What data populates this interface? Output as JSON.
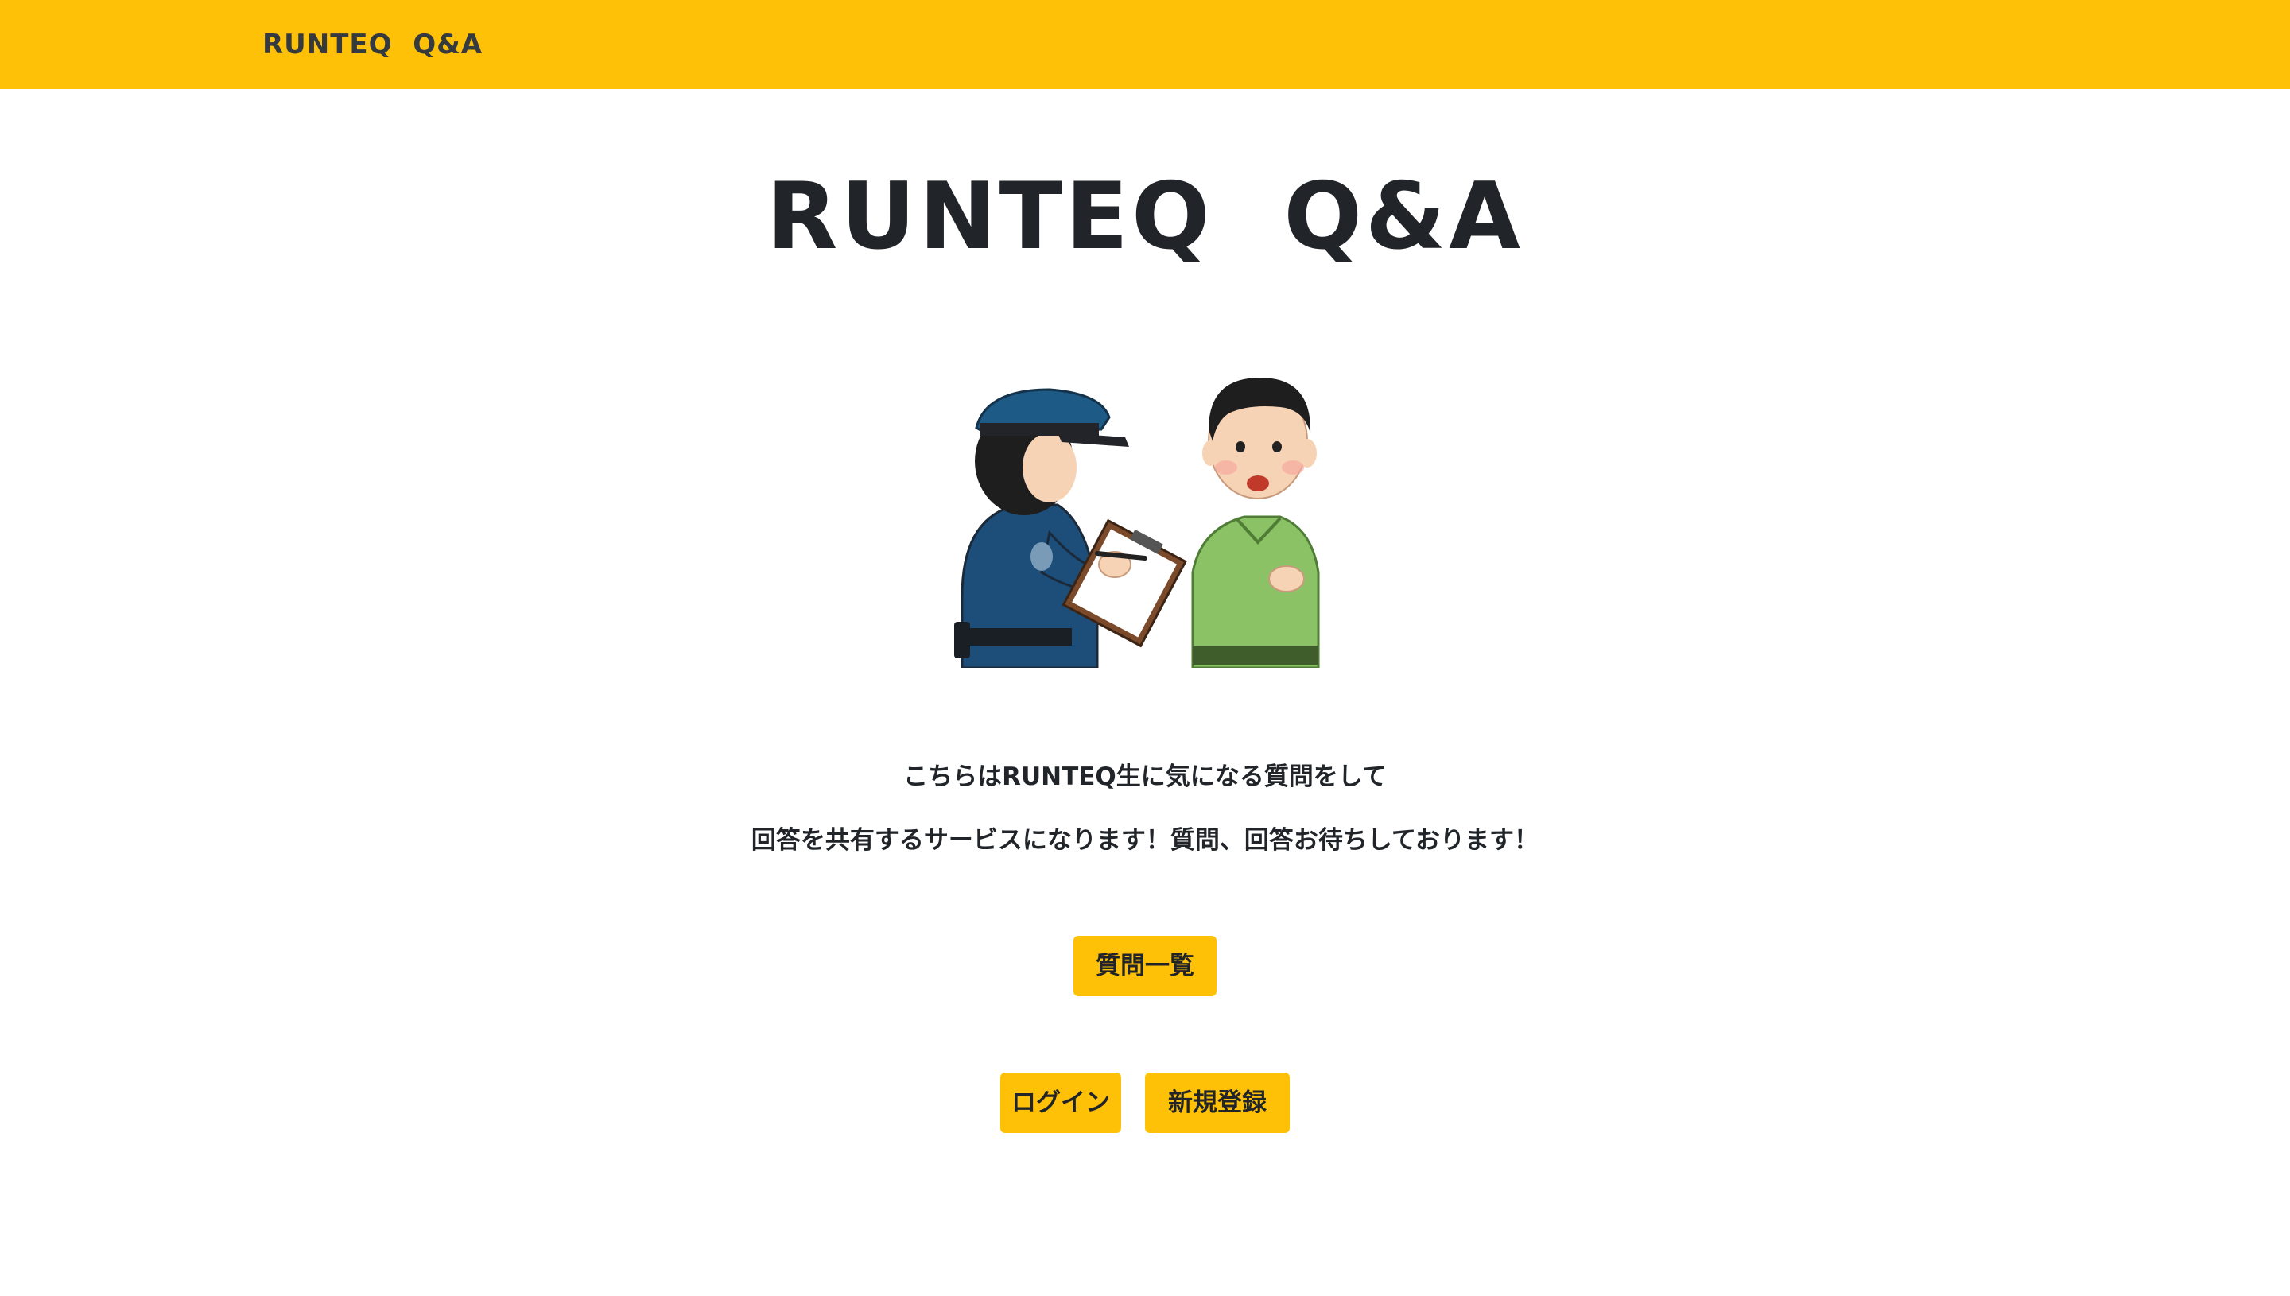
{
  "navbar": {
    "brand": "RUNTEQ  Q&A"
  },
  "hero": {
    "title": "RUNTEQ  Q&A",
    "illustration": "police-officer-questioning-person-illustration"
  },
  "intro": {
    "line1": "こちらはRUNTEQ生に気になる質問をして",
    "line2": "回答を共有するサービスになります！質問、回答お待ちしております！"
  },
  "actions": {
    "questions_label": "質問一覧",
    "login_label": "ログイン",
    "signup_label": "新規登録"
  },
  "colors": {
    "accent": "#ffc107",
    "text": "#212529",
    "background": "#ffffff"
  }
}
